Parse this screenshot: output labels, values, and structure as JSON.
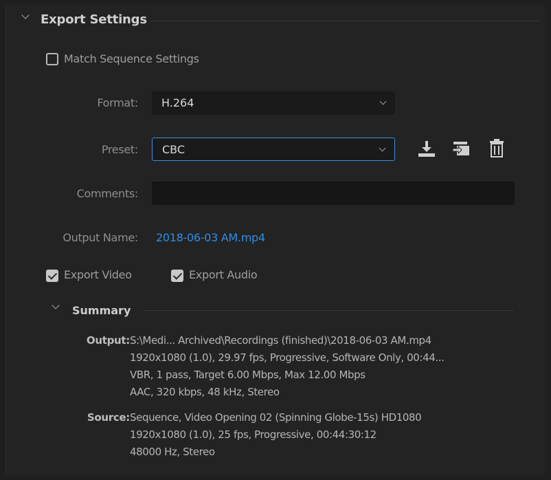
{
  "section": {
    "title": "Export Settings"
  },
  "match_sequence": {
    "label": "Match Sequence Settings",
    "checked": false
  },
  "format": {
    "label": "Format:",
    "value": "H.264"
  },
  "preset": {
    "label": "Preset:",
    "value": "CBC",
    "icons": [
      "save-preset-icon",
      "import-preset-icon",
      "delete-preset-icon"
    ]
  },
  "comments": {
    "label": "Comments:",
    "value": ""
  },
  "output_name": {
    "label": "Output Name:",
    "value": "2018-06-03 AM.mp4"
  },
  "export_video": {
    "label": "Export Video",
    "checked": true
  },
  "export_audio": {
    "label": "Export Audio",
    "checked": true
  },
  "summary": {
    "title": "Summary",
    "output": {
      "label": "Output:",
      "lines": [
        "S:\\Medi... Archived\\Recordings (finished)\\2018-06-03 AM.mp4",
        "1920x1080 (1.0), 29.97 fps, Progressive, Software Only, 00:44...",
        "VBR, 1 pass, Target 6.00 Mbps, Max 12.00 Mbps",
        "AAC, 320 kbps, 48 kHz, Stereo"
      ]
    },
    "source": {
      "label": "Source:",
      "lines": [
        "Sequence, Video Opening 02 (Spinning Globe-15s) HD1080",
        "1920x1080 (1.0), 25 fps, Progressive, 00:44:30:12",
        "48000 Hz, Stereo"
      ]
    }
  },
  "colors": {
    "background": "#232323",
    "accent": "#2e8ee6",
    "focus_border": "#3d8ee0"
  }
}
